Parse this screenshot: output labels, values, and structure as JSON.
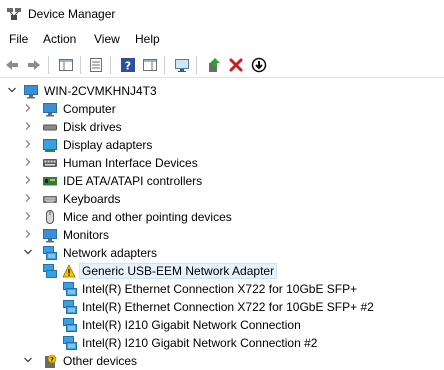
{
  "window": {
    "title": "Device Manager"
  },
  "menu": [
    "File",
    "Action",
    "View",
    "Help"
  ],
  "toolbar": {
    "buttons": [
      "back-icon",
      "forward-icon",
      "show-hide-console-tree-icon",
      "properties-icon",
      "help-icon",
      "action-pane-icon",
      "scan-hardware-icon",
      "update-driver-icon",
      "uninstall-icon",
      "disable-device-icon"
    ]
  },
  "tree": {
    "root": "WIN-2CVMKHNJ4T3",
    "categories": [
      {
        "label": "Computer",
        "icon": "computer-icon"
      },
      {
        "label": "Disk drives",
        "icon": "disk-drive-icon"
      },
      {
        "label": "Display adapters",
        "icon": "display-adapter-icon"
      },
      {
        "label": "Human Interface Devices",
        "icon": "hid-icon"
      },
      {
        "label": "IDE ATA/ATAPI controllers",
        "icon": "ide-controller-icon"
      },
      {
        "label": "Keyboards",
        "icon": "keyboard-icon"
      },
      {
        "label": "Mice and other pointing devices",
        "icon": "mouse-icon"
      },
      {
        "label": "Monitors",
        "icon": "monitor-icon"
      },
      {
        "label": "Network adapters",
        "icon": "network-adapter-icon",
        "expanded": true
      },
      {
        "label": "Other devices",
        "icon": "other-devices-icon"
      }
    ],
    "network_children": [
      {
        "label": "Generic USB-EEM Network Adapter",
        "icon": "warning-icon",
        "selected": true
      },
      {
        "label": "Intel(R) Ethernet Connection X722 for 10GbE SFP+",
        "icon": "network-adapter-icon"
      },
      {
        "label": "Intel(R) Ethernet Connection X722 for 10GbE SFP+ #2",
        "icon": "network-adapter-icon"
      },
      {
        "label": "Intel(R) I210 Gigabit Network Connection",
        "icon": "network-adapter-icon"
      },
      {
        "label": "Intel(R) I210 Gigabit Network Connection #2",
        "icon": "network-adapter-icon"
      }
    ]
  }
}
